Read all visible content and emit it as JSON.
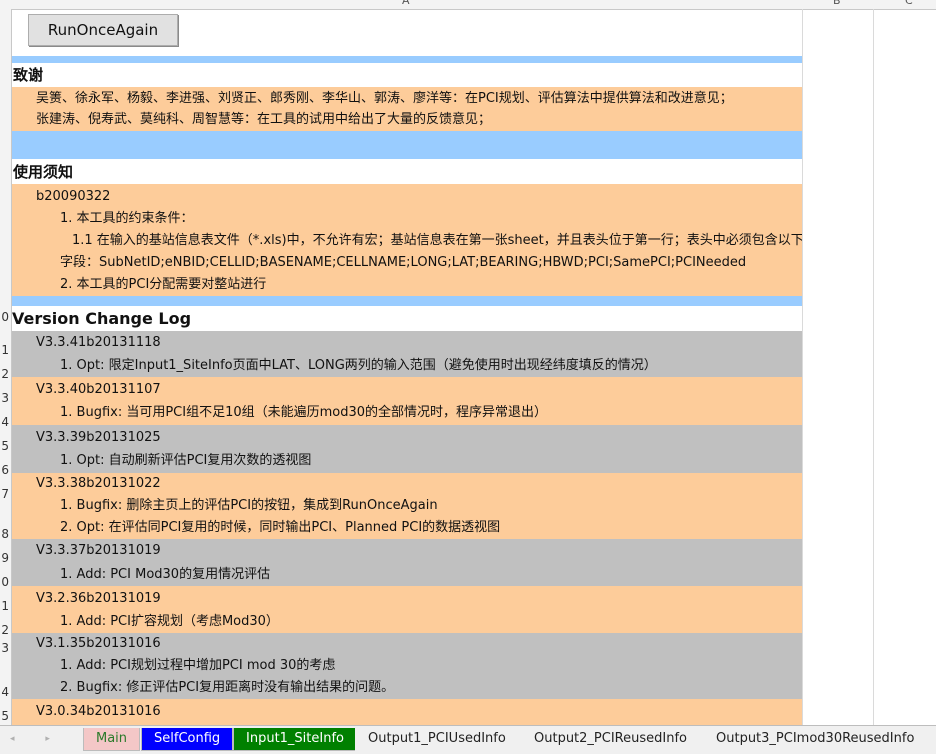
{
  "sheet": {
    "columns": [
      "A",
      "B",
      "C"
    ],
    "rows": [
      "0",
      "1",
      "2",
      "3",
      "4",
      "5",
      "6",
      "7",
      "8",
      "9",
      "0",
      "1",
      "2",
      "3",
      "4",
      "5"
    ]
  },
  "button": {
    "label": "RunOnceAgain"
  },
  "thanks": {
    "title": "致谢",
    "line1": "吴箦、徐永军、杨毅、李进强、刘贤正、郎秀刚、李华山、郭涛、廖洋等：在PCI规划、评估算法中提供算法和改进意见；",
    "line2": "张建涛、倪寿武、莫纯科、周智慧等：在工具的试用中给出了大量的反馈意见；"
  },
  "notice": {
    "title": "使用须知",
    "version": "b20090322",
    "line1": "1. 本工具的约束条件：",
    "line2": "1.1 在输入的基站信息表文件（*.xls)中，不允许有宏；基站信息表在第一张sheet，并且表头位于第一行；表头中必须包含以下",
    "line3": "字段：SubNetID;eNBID;CELLID;BASENAME;CELLNAME;LONG;LAT;BEARING;HBWD;PCI;SamePCI;PCINeeded",
    "line4": "2. 本工具的PCI分配需要对整站进行"
  },
  "log": {
    "title": "Version Change Log",
    "entries": [
      {
        "version": "V3.3.41b20131118",
        "items": [
          "1. Opt: 限定Input1_SiteInfo页面中LAT、LONG两列的输入范围（避免使用时出现经纬度填反的情况）"
        ]
      },
      {
        "version": "V3.3.40b20131107",
        "items": [
          "1. Bugfix: 当可用PCI组不足10组（未能遍历mod30的全部情况时，程序异常退出）"
        ]
      },
      {
        "version": "V3.3.39b20131025",
        "items": [
          "1. Opt: 自动刷新评估PCI复用次数的透视图"
        ]
      },
      {
        "version": "V3.3.38b20131022",
        "items": [
          "1. Bugfix: 删除主页上的评估PCI的按钮，集成到RunOnceAgain",
          "2. Opt: 在评估同PCI复用的时候，同时输出PCI、Planned PCI的数据透视图"
        ]
      },
      {
        "version": "V3.3.37b20131019",
        "items": [
          "1. Add: PCI Mod30的复用情况评估"
        ]
      },
      {
        "version": "V3.2.36b20131019",
        "items": [
          "1. Add: PCI扩容规划（考虑Mod30）"
        ]
      },
      {
        "version": "V3.1.35b20131016",
        "items": [
          "1. Add: PCI规划过程中增加PCI mod 30的考虑",
          "2. Bugfix: 修正评估PCI复用距离时没有输出结果的问题。"
        ]
      },
      {
        "version": "V3.0.34b20131016",
        "items": []
      }
    ]
  },
  "tabs": [
    {
      "label": "Main",
      "color": "#f4c7c7"
    },
    {
      "label": "SelfConfig",
      "color": "#0000ff"
    },
    {
      "label": "Input1_SiteInfo",
      "color": "#008000"
    },
    {
      "label": "Output1_PCIUsedInfo",
      "color": "#f0f0f0"
    },
    {
      "label": "Output2_PCIReusedInfo",
      "color": "#f0f0f0"
    },
    {
      "label": "Output3_PCImod30ReusedInfo",
      "color": "#f0f0f0"
    }
  ],
  "colors": {
    "peach": "#fdcc9a",
    "blue": "#99ccff",
    "gray": "#c0c0c0"
  }
}
